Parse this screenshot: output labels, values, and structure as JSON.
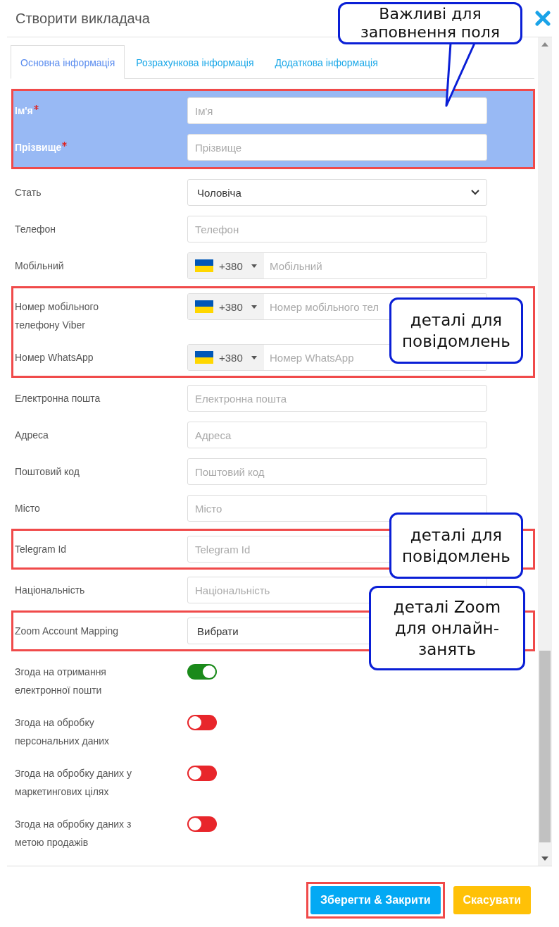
{
  "window": {
    "title": "Створити викладача"
  },
  "tabs": [
    {
      "label": "Основна інформація",
      "selected": true
    },
    {
      "label": "Розрахункова інформація",
      "selected": false
    },
    {
      "label": "Додаткова інформація",
      "selected": false
    }
  ],
  "groups": [
    {
      "kind": "framed_filled",
      "fields": [
        {
          "kind": "text",
          "label": "Ім'я",
          "required": true,
          "placeholder": "Ім'я"
        },
        {
          "kind": "text",
          "label": "Прізвище",
          "required": true,
          "placeholder": "Прізвище"
        }
      ]
    },
    {
      "kind": "plain",
      "fields": [
        {
          "kind": "select",
          "label": "Стать",
          "required": false,
          "value": "Чоловіча"
        },
        {
          "kind": "text",
          "label": "Телефон",
          "required": false,
          "placeholder": "Телефон"
        },
        {
          "kind": "phone",
          "label": "Мобільний",
          "required": false,
          "code": "+380",
          "placeholder": "Мобільний"
        }
      ]
    },
    {
      "kind": "framed",
      "fields": [
        {
          "kind": "phone",
          "label": "Номер мобільного телефону Viber",
          "required": false,
          "code": "+380",
          "placeholder": "Номер мобільного тел"
        },
        {
          "kind": "phone",
          "label": "Номер WhatsApp",
          "required": false,
          "code": "+380",
          "placeholder": "Номер WhatsApp"
        }
      ]
    },
    {
      "kind": "plain",
      "fields": [
        {
          "kind": "text",
          "label": "Електронна пошта",
          "required": false,
          "placeholder": "Електронна пошта"
        },
        {
          "kind": "text",
          "label": "Адреса",
          "required": false,
          "placeholder": "Адреса"
        },
        {
          "kind": "text",
          "label": "Поштовий код",
          "required": false,
          "placeholder": "Поштовий код"
        },
        {
          "kind": "text",
          "label": "Місто",
          "required": false,
          "placeholder": "Місто"
        }
      ]
    },
    {
      "kind": "framed",
      "fields": [
        {
          "kind": "text",
          "label": "Telegram Id",
          "required": false,
          "placeholder": "Telegram Id"
        }
      ]
    },
    {
      "kind": "plain",
      "fields": [
        {
          "kind": "text",
          "label": "Національність",
          "required": false,
          "placeholder": "Національність"
        }
      ]
    },
    {
      "kind": "framed",
      "fields": [
        {
          "kind": "select",
          "label": "Zoom Account Mapping",
          "required": false,
          "value": "Вибрати"
        }
      ]
    },
    {
      "kind": "plain",
      "fields": [
        {
          "kind": "toggle",
          "label": "Згода на отримання електронної пошти",
          "required": false,
          "on": true
        },
        {
          "kind": "toggle",
          "label": "Згода на обробку персональних даних",
          "required": false,
          "on": false
        },
        {
          "kind": "toggle",
          "label": "Згода на обробку даних у маркетингових цілях",
          "required": false,
          "on": false
        },
        {
          "kind": "toggle",
          "label": "Згода на обробку даних з метою продажів",
          "required": false,
          "on": false
        }
      ]
    }
  ],
  "buttons": [
    {
      "label": "Зберегти & Закрити",
      "kind": "primary",
      "framed": true
    },
    {
      "label": "Скасувати",
      "kind": "warning",
      "framed": false
    }
  ],
  "callouts": [
    {
      "text": "Важливі для заповнення поля",
      "tail": true
    },
    {
      "text": "деталі для повідомлень",
      "tail": false
    },
    {
      "text": "деталі для повідомлень",
      "tail": false
    },
    {
      "text": "деталі Zoom для онлайн-занять",
      "tail": false
    }
  ]
}
